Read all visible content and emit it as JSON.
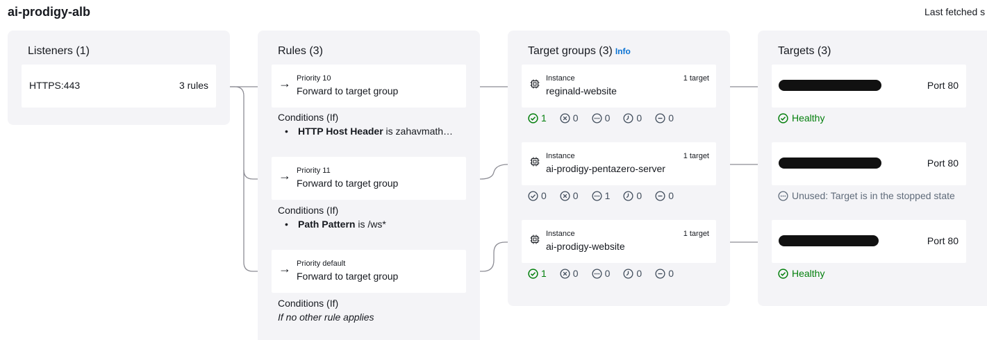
{
  "header": {
    "title": "ai-prodigy-alb",
    "last_fetched": "Last fetched s"
  },
  "listeners": {
    "title": "Listeners (1)",
    "items": [
      {
        "protocol": "HTTPS:443",
        "rules": "3 rules"
      }
    ]
  },
  "rules": {
    "title": "Rules (3)",
    "items": [
      {
        "priority": "Priority 10",
        "action": "Forward to target group",
        "conditions_label": "Conditions (If)",
        "condition_key": "HTTP Host Header",
        "condition_text": " is zahavmath…"
      },
      {
        "priority": "Priority 11",
        "action": "Forward to target group",
        "conditions_label": "Conditions (If)",
        "condition_key": "Path Pattern",
        "condition_text": " is /ws*"
      },
      {
        "priority": "Priority default",
        "action": "Forward to target group",
        "conditions_label": "Conditions (If)",
        "condition_default": "If no other rule applies"
      }
    ]
  },
  "target_groups": {
    "title": "Target groups (3)",
    "info_label": "Info",
    "items": [
      {
        "type": "Instance",
        "count": "1 target",
        "name": "reginald-website",
        "stats": {
          "healthy": "1",
          "unhealthy": "0",
          "unused": "0",
          "draining": "0",
          "unavailable": "0"
        }
      },
      {
        "type": "Instance",
        "count": "1 target",
        "name": "ai-prodigy-pentazero-server",
        "stats": {
          "healthy": "0",
          "unhealthy": "0",
          "unused": "1",
          "draining": "0",
          "unavailable": "0"
        }
      },
      {
        "type": "Instance",
        "count": "1 target",
        "name": "ai-prodigy-website",
        "stats": {
          "healthy": "1",
          "unhealthy": "0",
          "unused": "0",
          "draining": "0",
          "unavailable": "0"
        }
      }
    ]
  },
  "targets": {
    "title": "Targets (3)",
    "items": [
      {
        "port": "Port 80",
        "status": "Healthy",
        "status_kind": "healthy"
      },
      {
        "port": "Port 80",
        "status": "Unused: Target is in the stopped state",
        "status_kind": "unused"
      },
      {
        "port": "Port 80",
        "status": "Healthy",
        "status_kind": "healthy"
      }
    ]
  },
  "colors": {
    "panel_bg": "#f4f4f7",
    "healthy": "#037f0c",
    "link": "#0972d3",
    "connector": "#8c8c94",
    "muted": "#5f6b7a"
  },
  "icons": {
    "arrow": "arrow-right-icon",
    "instance": "chip-icon",
    "healthy": "check-circle-icon",
    "unhealthy": "x-circle-icon",
    "unused": "ellipsis-circle-icon",
    "draining": "clock-circle-icon",
    "unavailable": "minus-circle-icon"
  }
}
